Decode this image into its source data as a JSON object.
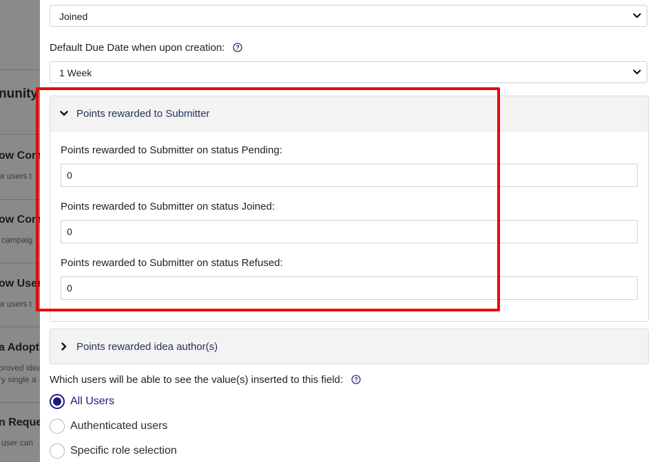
{
  "background": {
    "fragments": [
      {
        "kind": "big",
        "text": "nunity"
      },
      {
        "kind": "title",
        "text": "ow Comp"
      },
      {
        "kind": "desc",
        "text": "w users t"
      },
      {
        "kind": "title",
        "text": "ow Comp"
      },
      {
        "kind": "desc",
        "text": "campaig"
      },
      {
        "kind": "title",
        "text": "ow Users"
      },
      {
        "kind": "desc",
        "text": "w users t"
      },
      {
        "kind": "title",
        "text": "a Adopt"
      },
      {
        "kind": "desc",
        "text": "proved idea"
      },
      {
        "kind": "desc",
        "text": "ry single a"
      },
      {
        "kind": "title",
        "text": "n Reque"
      },
      {
        "kind": "desc",
        "text": "user can"
      }
    ]
  },
  "panel": {
    "status_select": {
      "value": "Joined",
      "icon": "chevron-down-icon"
    },
    "due_date": {
      "label": "Default Due Date when upon creation:",
      "help_icon": "help-circle-icon",
      "value": "1 Week"
    },
    "submitter_accordion": {
      "title": "Points rewarded to Submitter",
      "expanded": true,
      "fields": [
        {
          "label": "Points rewarded to Submitter on status Pending:",
          "value": "0"
        },
        {
          "label": "Points rewarded to Submitter on status Joined:",
          "value": "0"
        },
        {
          "label": "Points rewarded to Submitter on status Refused:",
          "value": "0"
        }
      ]
    },
    "author_accordion": {
      "title": "Points rewarded idea author(s)",
      "expanded": false
    },
    "visibility": {
      "label": "Which users will be able to see the value(s) inserted to this field:",
      "help_icon": "help-circle-icon",
      "options": [
        {
          "label": "All Users",
          "checked": true
        },
        {
          "label": "Authenticated users",
          "checked": false
        },
        {
          "label": "Specific role selection",
          "checked": false
        }
      ]
    }
  },
  "colors": {
    "accent": "#1a1a7a",
    "highlight": "#ee0000",
    "accordion_title": "#25305e"
  }
}
